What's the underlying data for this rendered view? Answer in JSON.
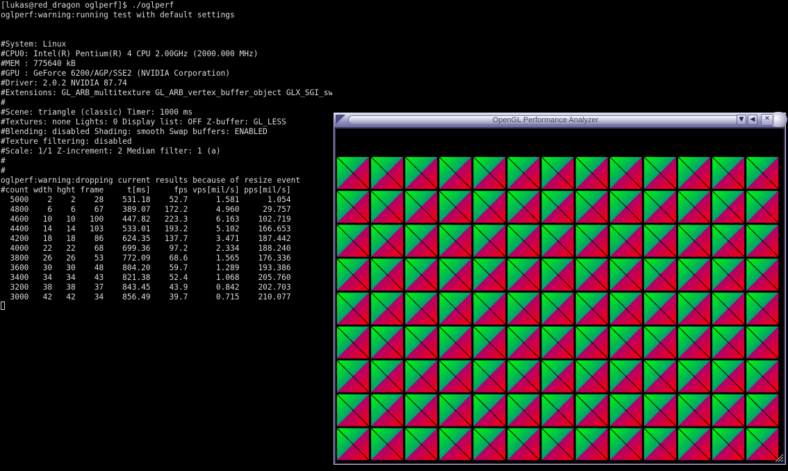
{
  "terminal": {
    "lines": [
      "[lukas@red_dragon oglperf]$ ./oglperf",
      "oglperf:warning:running test with default settings",
      "",
      "",
      "#System: Linux",
      "#CPU0: Intel(R) Pentium(R) 4 CPU 2.00GHz (2000.000 MHz)",
      "#MEM : 775640 kB",
      "#GPU : GeForce 6200/AGP/SSE2 (NVIDIA Corporation)",
      "#Driver: 2.0.2 NVIDIA 87.74",
      "#Extensions: GL_ARB_multitexture GL_ARB_vertex_buffer_object GLX_SGI_swap_control",
      "#",
      "#Scene: triangle (classic) Timer: 1000 ms",
      "#Textures: none Lights: 0 Display list: OFF Z-buffer: GL_LESS",
      "#Blending: disabled Shading: smooth Swap buffers: ENABLED",
      "#Texture filtering: disabled",
      "#Scale: 1/1 Z-increment: 2 Median filter: 1 (a)",
      "#",
      "#",
      "oglperf:warning:dropping current results because of resize event",
      "#count wdth hght frame     t[ms]     fps vps[mil/s] pps[mil/s]",
      "  5000    2    2    28    531.18    52.7      1.581      1.054",
      "  4800    6    6    67    389.07   172.2      4.960     29.757",
      "  4600   10   10   100    447.82   223.3      6.163    102.719",
      "  4400   14   14   103    533.01   193.2      5.102    166.653",
      "  4200   18   18    86    624.35   137.7      3.471    187.442",
      "  4000   22   22    68    699.36    97.2      2.334    188.240",
      "  3800   26   26    53    772.09    68.6      1.565    176.336",
      "  3600   30   30    48    804.20    59.7      1.289    193.386",
      "  3400   34   34    43    821.38    52.4      1.068    205.760",
      "  3200   38   38    37    843.45    43.9      0.842    202.703",
      "  3000   42   42    34    856.49    39.7      0.715    210.077"
    ],
    "text_color": "#dcdcdc",
    "background": "#000000"
  },
  "window": {
    "title": "OpenGL Performance Analyzer",
    "menu_icon": "triangle-down-icon",
    "minimize_icon": "triangle-left-icon",
    "close_icon": "close-icon",
    "frame_color": "#3a3a66",
    "titlebar_color": "#9a9ac4"
  },
  "render": {
    "columns": 13,
    "rows": 9,
    "colors": {
      "corner_a": "#00ff00",
      "corner_b": "#0000ff",
      "corner_c": "#ff0000",
      "edge": "#000000"
    }
  }
}
